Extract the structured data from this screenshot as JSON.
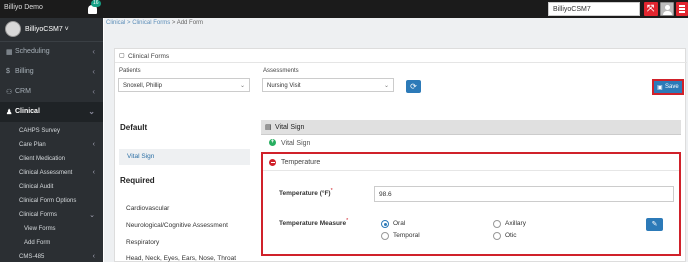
{
  "app": {
    "brand": "Billiyo Demo",
    "notification_count": "16",
    "user_chip": "BilliyoCSM7"
  },
  "sidebar": {
    "profile_name": "BilliyoCSM7 ˅",
    "items": [
      {
        "label": "Scheduling",
        "icon": "calendar-icon"
      },
      {
        "label": "Billing",
        "icon": "dollar-icon"
      },
      {
        "label": "CRM",
        "icon": "users-icon"
      },
      {
        "label": "Clinical",
        "icon": "user-md-icon"
      }
    ],
    "clinical_sub": [
      {
        "label": "CAHPS Survey"
      },
      {
        "label": "Care Plan"
      },
      {
        "label": "Client Medication"
      },
      {
        "label": "Clinical Assessment"
      },
      {
        "label": "Clinical Audit"
      },
      {
        "label": "Clinical Form Options"
      },
      {
        "label": "Clinical Forms"
      }
    ],
    "forms_sub": [
      {
        "label": "View Forms"
      },
      {
        "label": "Add Form"
      }
    ],
    "cms_item": "CMS-485"
  },
  "breadcrumb": {
    "clinical": "Clinical",
    "sep1": " > ",
    "clinical_forms": "Clinical Forms",
    "sep2": " > ",
    "current": "Add Form"
  },
  "panel": {
    "title": "Clinical Forms",
    "patients_label": "Patients",
    "patient_value": "Snoxell, Phillip",
    "assessments_label": "Assessments",
    "assessment_value": "Nursing Visit",
    "save_label": "Save"
  },
  "left": {
    "default_heading": "Default",
    "default_item": "Vital Sign",
    "required_heading": "Required",
    "required_items": [
      "Cardiovascular",
      "Neurological/Cognitive Assessment",
      "Respiratory",
      "Head, Neck, Eyes, Ears, Nose, Throat"
    ]
  },
  "section": {
    "title": "Vital Sign",
    "vital_sign_sub": "Vital Sign",
    "temperature_title": "Temperature",
    "temp_label": "Temperature (°F)",
    "temp_value": "98.6",
    "measure_label": "Temperature Measure",
    "required_mark": "*",
    "options": [
      {
        "label": "Oral",
        "selected": true
      },
      {
        "label": "Axillary",
        "selected": false
      },
      {
        "label": "Temporal",
        "selected": false
      },
      {
        "label": "Otic",
        "selected": false
      }
    ]
  },
  "colors": {
    "accent": "#2c7ab8",
    "highlight": "#d0212a",
    "sidebar": "#2b2f33"
  }
}
